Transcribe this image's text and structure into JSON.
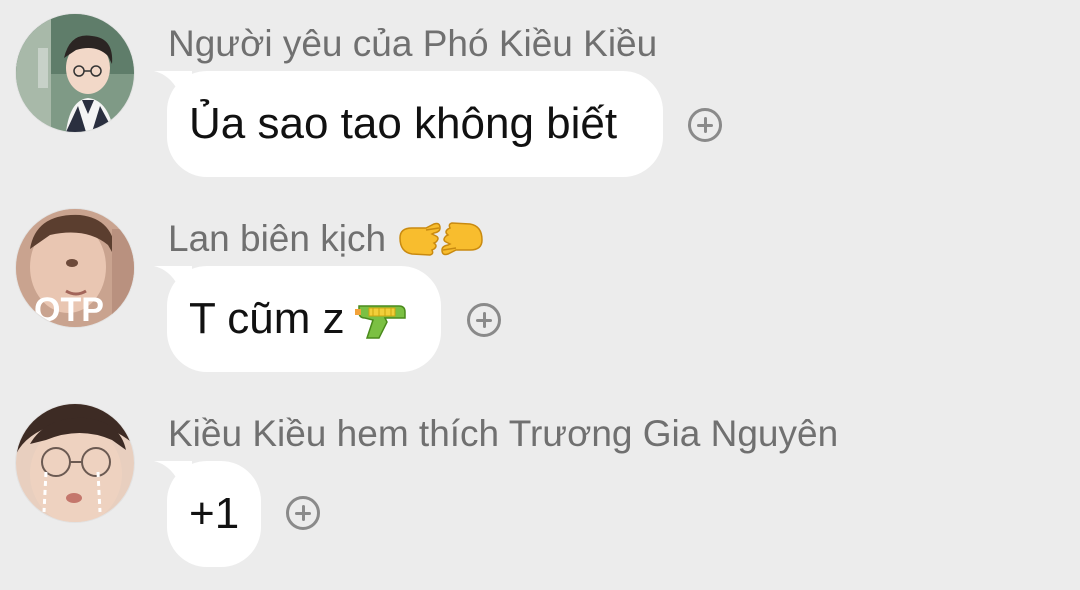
{
  "messages": [
    {
      "sender": "Người yêu của Phó Kiều Kiều",
      "text": "Ủa sao tao không biết",
      "avatar_icon": "avatar-boy-glasses"
    },
    {
      "sender": "Lan biên kịch",
      "sender_emoji": "hands-pointing-emoji",
      "text": "T cũm z",
      "text_emoji": "water-gun-emoji",
      "avatar_icon": "avatar-boy-otp",
      "avatar_text": "OTP"
    },
    {
      "sender": "Kiều Kiều hem thích Trương Gia Nguyên",
      "text": "+1",
      "avatar_icon": "avatar-boy-crying"
    }
  ],
  "colors": {
    "background": "#ececec",
    "bubble": "#ffffff",
    "sender_text": "#707070",
    "message_text": "#111111",
    "icon_gray": "#8a8a8a"
  }
}
